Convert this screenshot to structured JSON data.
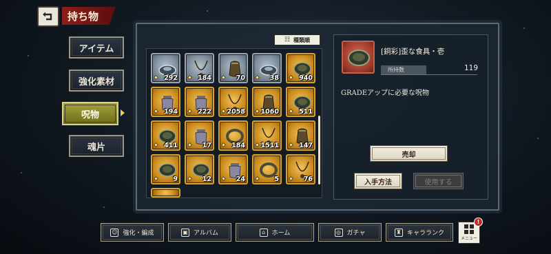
{
  "header": {
    "title": "持ち物",
    "back_icon": "back-arrow-icon"
  },
  "categories": [
    {
      "label": "アイテム",
      "active": false
    },
    {
      "label": "強化素材",
      "active": false
    },
    {
      "label": "呪物",
      "active": true
    },
    {
      "label": "魂片",
      "active": false
    }
  ],
  "sort": {
    "label": "種類順",
    "icon": "sort-list-icon"
  },
  "grid": {
    "items": [
      {
        "count": "292",
        "rarity": "silver",
        "shape": "dish"
      },
      {
        "count": "184",
        "rarity": "silver",
        "shape": "necklace"
      },
      {
        "count": "70",
        "rarity": "silver",
        "shape": "pouch"
      },
      {
        "count": "38",
        "rarity": "silver",
        "shape": "dish"
      },
      {
        "count": "940",
        "rarity": "gold",
        "shape": "bowl"
      },
      {
        "count": "194",
        "rarity": "gold",
        "shape": "jar"
      },
      {
        "count": "222",
        "rarity": "gold",
        "shape": "jar"
      },
      {
        "count": "2058",
        "rarity": "gold",
        "shape": "necklace"
      },
      {
        "count": "1060",
        "rarity": "gold",
        "shape": "pouch"
      },
      {
        "count": "511",
        "rarity": "gold",
        "shape": "bowl"
      },
      {
        "count": "411",
        "rarity": "gold",
        "shape": "bowl"
      },
      {
        "count": "17",
        "rarity": "gold",
        "shape": "jar"
      },
      {
        "count": "184",
        "rarity": "gold",
        "shape": "bracelet"
      },
      {
        "count": "1511",
        "rarity": "gold",
        "shape": "necklace"
      },
      {
        "count": "147",
        "rarity": "gold",
        "shape": "pouch"
      },
      {
        "count": "9",
        "rarity": "gold",
        "shape": "bowl"
      },
      {
        "count": "12",
        "rarity": "gold",
        "shape": "bowl"
      },
      {
        "count": "24",
        "rarity": "gold",
        "shape": "jar"
      },
      {
        "count": "5",
        "rarity": "gold",
        "shape": "bracelet"
      },
      {
        "count": "76",
        "rarity": "gold",
        "shape": "necklace"
      }
    ]
  },
  "detail": {
    "name": "[銅彩]歪な食具・壱",
    "owned_label": "所持数",
    "owned_count": "119",
    "description": "GRADEアップに必要な呪物",
    "sell_label": "売却",
    "obtain_label": "入手方法",
    "use_label": "使用する"
  },
  "bottom_nav": [
    {
      "label": "強化・編成",
      "icon": "team-icon"
    },
    {
      "label": "アルバム",
      "icon": "album-icon"
    },
    {
      "label": "ホーム",
      "icon": "home-icon"
    },
    {
      "label": "ガチャ",
      "icon": "gacha-icon"
    },
    {
      "label": "キャラランク",
      "icon": "rank-icon"
    }
  ],
  "menu": {
    "label": "メニュー",
    "badge": "!"
  },
  "colors": {
    "accent_red": "#8e1d1a",
    "gold": "#d9a42b",
    "active_tab": "#a4a23c"
  }
}
